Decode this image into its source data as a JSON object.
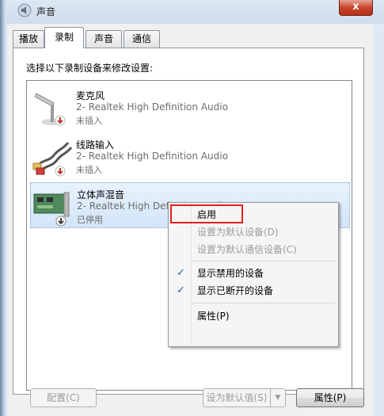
{
  "window": {
    "title": "声音",
    "close_label": "x"
  },
  "tabs": [
    {
      "label": "播放",
      "active": false
    },
    {
      "label": "录制",
      "active": true
    },
    {
      "label": "声音",
      "active": false
    },
    {
      "label": "通信",
      "active": false
    }
  ],
  "instruction": "选择以下录制设备来修改设置:",
  "devices": [
    {
      "name": "麦克风",
      "description": "2- Realtek High Definition Audio",
      "status": "未插入",
      "icon": "microphone-icon"
    },
    {
      "name": "线路输入",
      "description": "2- Realtek High Definition Audio",
      "status": "未插入",
      "icon": "line-in-cable-icon"
    },
    {
      "name": "立体声混音",
      "description": "2- Realtek High Definition Audio",
      "status": "已停用",
      "icon": "sound-card-icon",
      "selected": true
    }
  ],
  "context_menu": {
    "items": [
      {
        "label": "启用",
        "enabled": true,
        "checked": false
      },
      {
        "label": "设置为默认设备(D)",
        "enabled": false,
        "checked": false
      },
      {
        "label": "设置为默认通信设备(C)",
        "enabled": false,
        "checked": false
      },
      {
        "label": "显示禁用的设备",
        "enabled": true,
        "checked": true
      },
      {
        "label": "显示已断开的设备",
        "enabled": true,
        "checked": true
      },
      {
        "label": "属性(P)",
        "enabled": true,
        "checked": false
      }
    ]
  },
  "buttons": {
    "configure": "配置(C)",
    "set_default": "设为默认值(S)",
    "properties": "属性(P)"
  },
  "colors": {
    "highlight_box": "#e02020",
    "close_button": "#c9452c",
    "selection": "#d2e5f9"
  }
}
